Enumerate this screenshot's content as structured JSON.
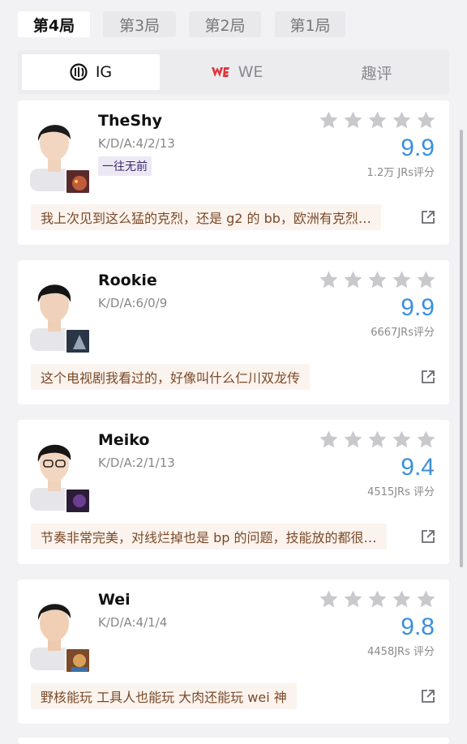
{
  "rounds": [
    "第4局",
    "第3局",
    "第2局",
    "第1局"
  ],
  "teams": [
    "IG",
    "WE",
    "趣评"
  ],
  "players": [
    {
      "name": "TheShy",
      "kda": "K/D/A:4/2/13",
      "tag": "一往无前",
      "score": "9.9",
      "count": "1.2万 JRs评分",
      "comment": "我上次见到这么猛的克烈，还是 g2 的 bb，欧洲有克烈…",
      "rating_stars": 5
    },
    {
      "name": "Rookie",
      "kda": "K/D/A:6/0/9",
      "tag": "",
      "score": "9.9",
      "count": "6667JRs评分",
      "comment": "这个电视剧我看过的，好像叫什么仁川双龙传",
      "rating_stars": 5
    },
    {
      "name": "Meiko",
      "kda": "K/D/A:2/1/13",
      "tag": "",
      "score": "9.4",
      "count": "4515JRs 评分",
      "comment": "节奏非常完美，对线烂掉也是 bp 的问题，技能放的都很…",
      "rating_stars": 5
    },
    {
      "name": "Wei",
      "kda": "K/D/A:4/1/4",
      "tag": "",
      "score": "9.8",
      "count": "4458JRs 评分",
      "comment": "野核能玩 工具人也能玩 大肉还能玩 wei 神",
      "rating_stars": 5
    }
  ],
  "colors": {
    "score": "#3a8fdf",
    "we_red": "#e0363c",
    "comment_bg": "#fbf3ed"
  }
}
